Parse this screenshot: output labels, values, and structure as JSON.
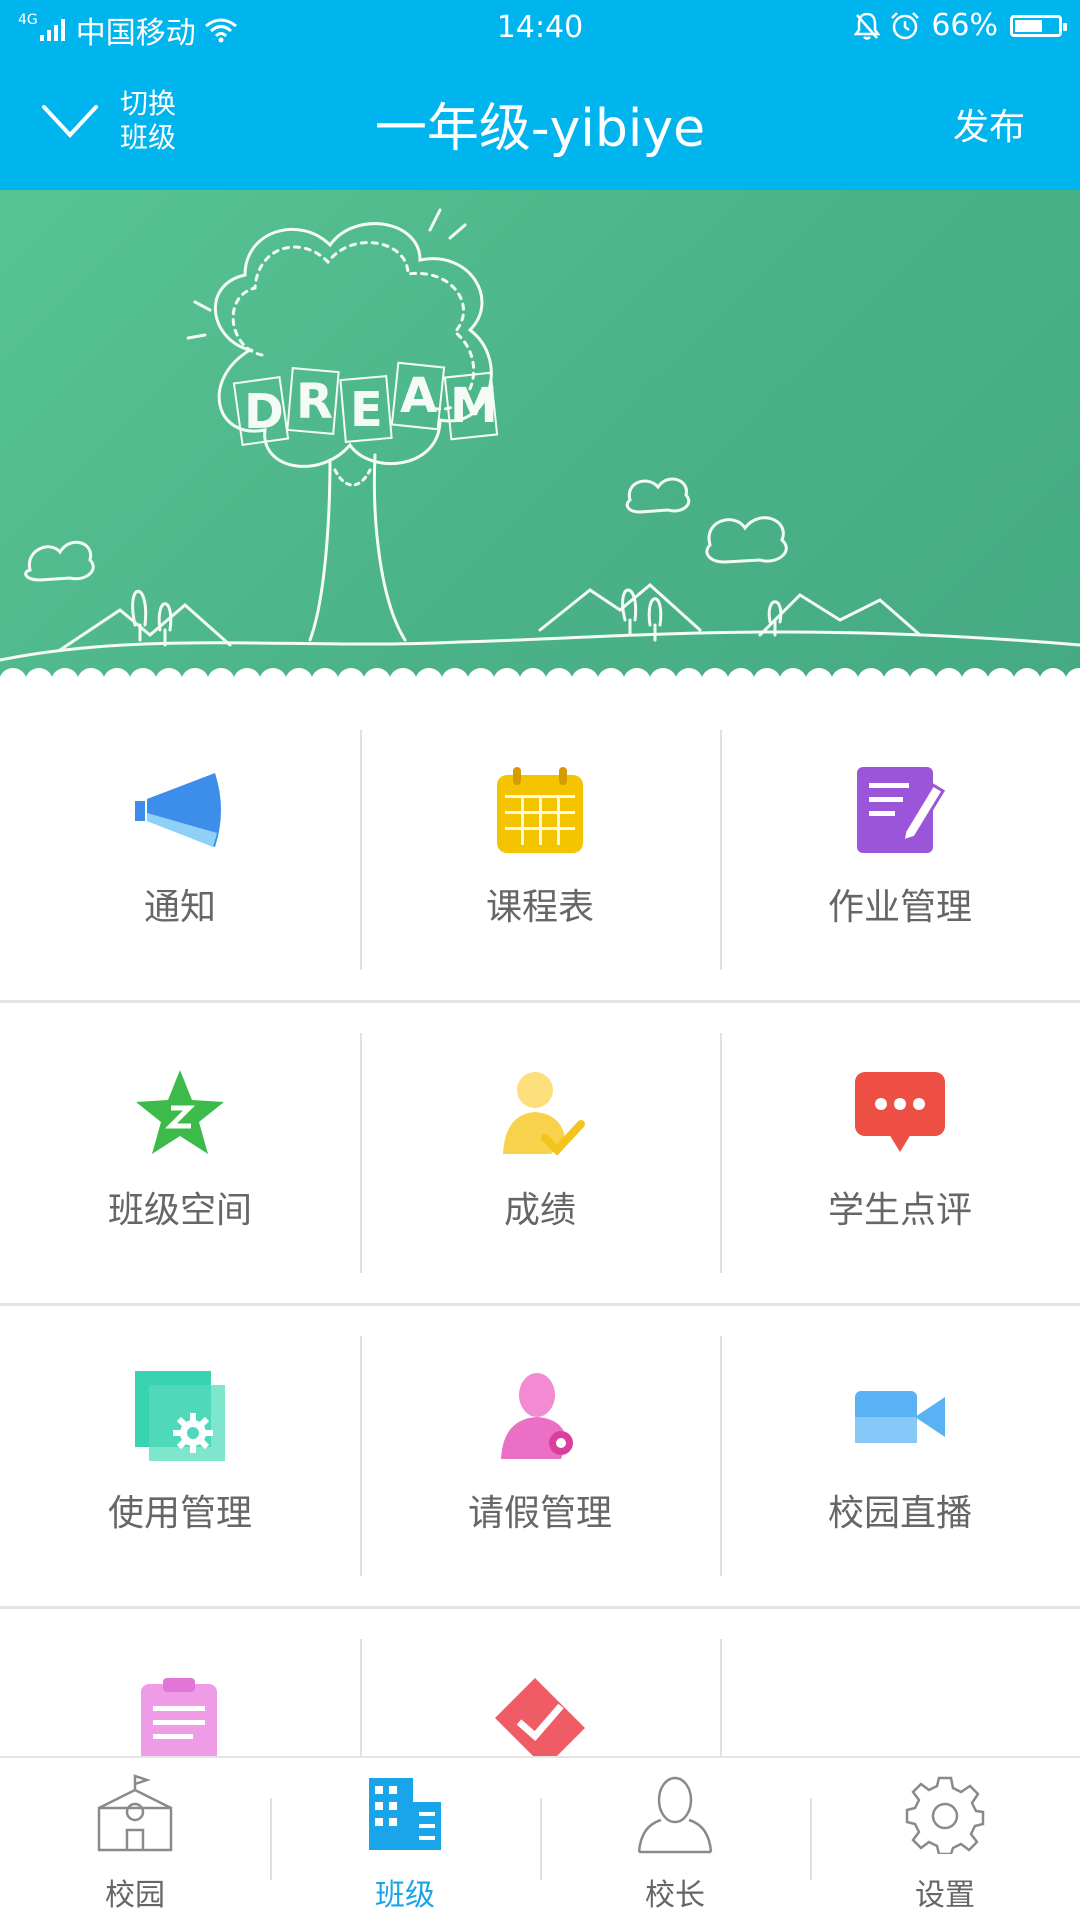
{
  "status_bar": {
    "network": "4G",
    "carrier": "中国移动",
    "time": "14:40",
    "battery": "66%",
    "battery_level": 0.66
  },
  "header": {
    "switch_label_line1": "切换",
    "switch_label_line2": "班级",
    "title": "一年级-yibiye",
    "publish_label": "发布"
  },
  "banner": {
    "text": "DREAM"
  },
  "grid": {
    "items": [
      {
        "label": "通知",
        "icon": "megaphone-icon",
        "color": "#3d8eea"
      },
      {
        "label": "课程表",
        "icon": "calendar-icon",
        "color": "#f5c400"
      },
      {
        "label": "作业管理",
        "icon": "homework-icon",
        "color": "#9a55d8"
      },
      {
        "label": "班级空间",
        "icon": "qzone-star-icon",
        "color": "#3dbb4a"
      },
      {
        "label": "成绩",
        "icon": "grade-icon",
        "color": "#fbd966"
      },
      {
        "label": "学生点评",
        "icon": "comment-icon",
        "color": "#ee4f45"
      },
      {
        "label": "使用管理",
        "icon": "settings-doc-icon",
        "color": "#3ad3b2"
      },
      {
        "label": "请假管理",
        "icon": "leave-icon",
        "color": "#ec6fc6"
      },
      {
        "label": "校园直播",
        "icon": "video-camera-icon",
        "color": "#5ab1f3"
      },
      {
        "label": "",
        "icon": "clipboard-icon",
        "color": "#ef9ce6"
      },
      {
        "label": "",
        "icon": "check-icon",
        "color": "#ef5c66"
      },
      {
        "label": "",
        "icon": "",
        "color": ""
      }
    ]
  },
  "tabbar": {
    "tabs": [
      {
        "label": "校园",
        "icon": "school-icon"
      },
      {
        "label": "班级",
        "icon": "class-building-icon",
        "active": true
      },
      {
        "label": "校长",
        "icon": "principal-icon"
      },
      {
        "label": "设置",
        "icon": "settings-gear-icon"
      }
    ]
  }
}
